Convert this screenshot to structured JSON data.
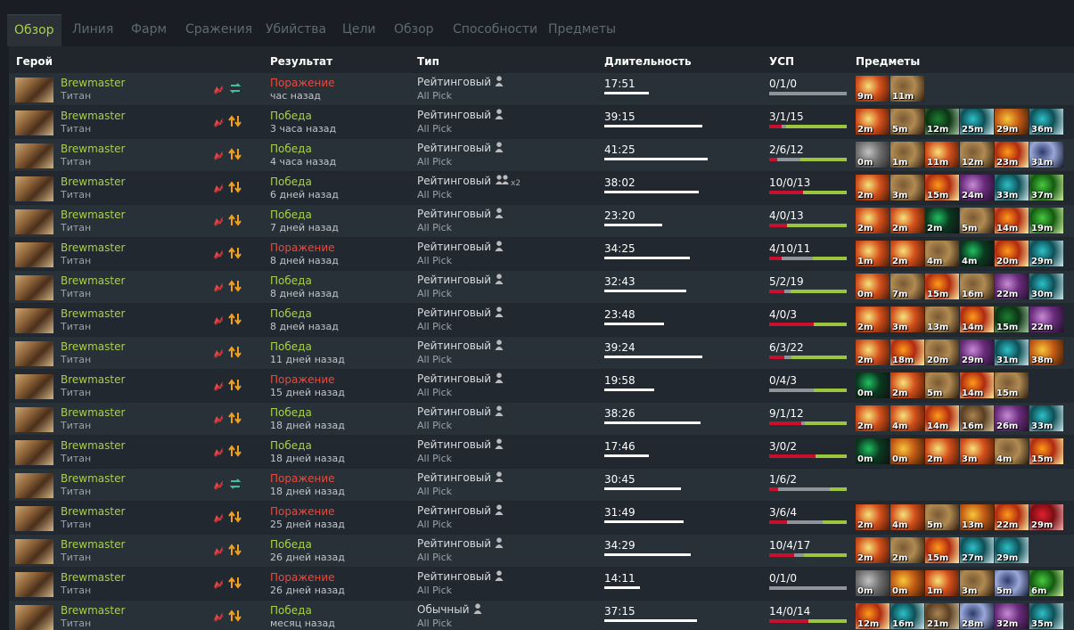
{
  "tabs": [
    "Обзор",
    "Линия",
    "Фарм",
    "Сражения",
    "Убийства",
    "Цели",
    "Обзор",
    "Способности",
    "Предметы"
  ],
  "active_tab": 0,
  "columns": {
    "hero": "Герой",
    "result": "Результат",
    "type": "Тип",
    "duration": "Длительность",
    "kda": "УСП",
    "items": "Предметы"
  },
  "colors": {
    "green": "#a8d04a",
    "red": "#e64b3c",
    "bar_kills": "#c8102e",
    "bar_assists": "#9bc53d",
    "bar_deaths": "#8e9499"
  },
  "item_palette": {
    "1": [
      "#f6e27a",
      "#d4501c",
      "#4a1a06"
    ],
    "2": [
      "#7a5a34",
      "#b08a52",
      "#2a1a0c"
    ],
    "3": [
      "#1d7d33",
      "#0c3214",
      "#a4c8a0"
    ],
    "4": [
      "#2ec0c8",
      "#0d4f56",
      "#cfeaf0"
    ],
    "5": [
      "#f7c63a",
      "#c25a15",
      "#3a1d08"
    ],
    "6": [
      "#2a3a6a",
      "#9aa7d8",
      "#101830"
    ],
    "7": [
      "#c78bd6",
      "#6a2c7c",
      "#22102c"
    ],
    "8": [
      "#48c940",
      "#125a10",
      "#d0f0a0"
    ],
    "9": [
      "#c2c2c2",
      "#6e6e6e",
      "#2a2a2a"
    ],
    "10": [
      "#e02030",
      "#7a0d12",
      "#f4b0b0"
    ],
    "11": [
      "#ff9a1a",
      "#b02a10",
      "#fff0a0"
    ],
    "12": [
      "#a88452",
      "#5a3e22",
      "#d8c39a"
    ],
    "13": [
      "#20c060",
      "#0a3a20",
      "#101010"
    ]
  },
  "rows": [
    {
      "hero": "Brewmaster",
      "hero_sub": "Титан",
      "mode": "rank",
      "result": "Поражение",
      "outcome": "loss",
      "time": "час назад",
      "type": "Рейтинговый",
      "party": "solo",
      "party_count": "",
      "sub": "All Pick",
      "duration": "17:51",
      "duration_minutes": 17.85,
      "kda": "0/1/0",
      "k": 0,
      "d": 1,
      "a": 0,
      "items": [
        {
          "t": "9m",
          "c": "1"
        },
        {
          "t": "11m",
          "c": "2"
        }
      ]
    },
    {
      "hero": "Brewmaster",
      "hero_sub": "Титан",
      "mode": "arrow",
      "result": "Победа",
      "outcome": "win",
      "time": "3 часа назад",
      "type": "Рейтинговый",
      "party": "solo",
      "party_count": "",
      "sub": "All Pick",
      "duration": "39:15",
      "duration_minutes": 39.25,
      "kda": "3/1/15",
      "k": 3,
      "d": 1,
      "a": 15,
      "items": [
        {
          "t": "2m",
          "c": "1"
        },
        {
          "t": "5m",
          "c": "2"
        },
        {
          "t": "12m",
          "c": "3"
        },
        {
          "t": "25m",
          "c": "4"
        },
        {
          "t": "29m",
          "c": "5"
        },
        {
          "t": "36m",
          "c": "4"
        }
      ]
    },
    {
      "hero": "Brewmaster",
      "hero_sub": "Титан",
      "mode": "arrow",
      "result": "Победа",
      "outcome": "win",
      "time": "4 часа назад",
      "type": "Рейтинговый",
      "party": "solo",
      "party_count": "",
      "sub": "All Pick",
      "duration": "41:25",
      "duration_minutes": 41.42,
      "kda": "2/6/12",
      "k": 2,
      "d": 6,
      "a": 12,
      "items": [
        {
          "t": "0m",
          "c": "9"
        },
        {
          "t": "1m",
          "c": "2"
        },
        {
          "t": "11m",
          "c": "1"
        },
        {
          "t": "12m",
          "c": "2"
        },
        {
          "t": "23m",
          "c": "11"
        },
        {
          "t": "31m",
          "c": "6"
        }
      ]
    },
    {
      "hero": "Brewmaster",
      "hero_sub": "Титан",
      "mode": "arrow",
      "result": "Победа",
      "outcome": "win",
      "time": "6 дней назад",
      "type": "Рейтинговый",
      "party": "group",
      "party_count": "x2",
      "sub": "All Pick",
      "duration": "38:02",
      "duration_minutes": 38.03,
      "kda": "10/0/13",
      "k": 10,
      "d": 0,
      "a": 13,
      "items": [
        {
          "t": "2m",
          "c": "1"
        },
        {
          "t": "3m",
          "c": "2"
        },
        {
          "t": "15m",
          "c": "11"
        },
        {
          "t": "24m",
          "c": "7"
        },
        {
          "t": "33m",
          "c": "4"
        },
        {
          "t": "37m",
          "c": "8"
        }
      ]
    },
    {
      "hero": "Brewmaster",
      "hero_sub": "Титан",
      "mode": "arrow",
      "result": "Победа",
      "outcome": "win",
      "time": "7 дней назад",
      "type": "Рейтинговый",
      "party": "solo",
      "party_count": "",
      "sub": "All Pick",
      "duration": "23:20",
      "duration_minutes": 23.33,
      "kda": "4/0/13",
      "k": 4,
      "d": 0,
      "a": 13,
      "items": [
        {
          "t": "2m",
          "c": "1"
        },
        {
          "t": "2m",
          "c": "1"
        },
        {
          "t": "2m",
          "c": "13"
        },
        {
          "t": "5m",
          "c": "2"
        },
        {
          "t": "14m",
          "c": "11"
        },
        {
          "t": "19m",
          "c": "8"
        }
      ]
    },
    {
      "hero": "Brewmaster",
      "hero_sub": "Титан",
      "mode": "arrow",
      "result": "Поражение",
      "outcome": "loss",
      "time": "8 дней назад",
      "type": "Рейтинговый",
      "party": "solo",
      "party_count": "",
      "sub": "All Pick",
      "duration": "34:25",
      "duration_minutes": 34.42,
      "kda": "4/10/11",
      "k": 4,
      "d": 10,
      "a": 11,
      "items": [
        {
          "t": "1m",
          "c": "1"
        },
        {
          "t": "2m",
          "c": "1"
        },
        {
          "t": "4m",
          "c": "2"
        },
        {
          "t": "4m",
          "c": "13"
        },
        {
          "t": "20m",
          "c": "11"
        },
        {
          "t": "29m",
          "c": "4"
        }
      ]
    },
    {
      "hero": "Brewmaster",
      "hero_sub": "Титан",
      "mode": "arrow",
      "result": "Победа",
      "outcome": "win",
      "time": "8 дней назад",
      "type": "Рейтинговый",
      "party": "solo",
      "party_count": "",
      "sub": "All Pick",
      "duration": "32:43",
      "duration_minutes": 32.72,
      "kda": "5/2/19",
      "k": 5,
      "d": 2,
      "a": 19,
      "items": [
        {
          "t": "0m",
          "c": "1"
        },
        {
          "t": "7m",
          "c": "2"
        },
        {
          "t": "15m",
          "c": "11"
        },
        {
          "t": "16m",
          "c": "2"
        },
        {
          "t": "22m",
          "c": "7"
        },
        {
          "t": "30m",
          "c": "4"
        }
      ]
    },
    {
      "hero": "Brewmaster",
      "hero_sub": "Титан",
      "mode": "arrow",
      "result": "Победа",
      "outcome": "win",
      "time": "8 дней назад",
      "type": "Рейтинговый",
      "party": "solo",
      "party_count": "",
      "sub": "All Pick",
      "duration": "23:48",
      "duration_minutes": 23.8,
      "kda": "4/0/3",
      "k": 4,
      "d": 0,
      "a": 3,
      "items": [
        {
          "t": "2m",
          "c": "1"
        },
        {
          "t": "3m",
          "c": "1"
        },
        {
          "t": "13m",
          "c": "2"
        },
        {
          "t": "14m",
          "c": "11"
        },
        {
          "t": "15m",
          "c": "3"
        },
        {
          "t": "22m",
          "c": "7"
        }
      ]
    },
    {
      "hero": "Brewmaster",
      "hero_sub": "Титан",
      "mode": "arrow",
      "result": "Победа",
      "outcome": "win",
      "time": "11 дней назад",
      "type": "Рейтинговый",
      "party": "solo",
      "party_count": "",
      "sub": "All Pick",
      "duration": "39:24",
      "duration_minutes": 39.4,
      "kda": "6/3/22",
      "k": 6,
      "d": 3,
      "a": 22,
      "items": [
        {
          "t": "2m",
          "c": "1"
        },
        {
          "t": "18m",
          "c": "11"
        },
        {
          "t": "20m",
          "c": "2"
        },
        {
          "t": "29m",
          "c": "7"
        },
        {
          "t": "31m",
          "c": "4"
        },
        {
          "t": "38m",
          "c": "5"
        }
      ]
    },
    {
      "hero": "Brewmaster",
      "hero_sub": "Титан",
      "mode": "arrow",
      "result": "Поражение",
      "outcome": "loss",
      "time": "15 дней назад",
      "type": "Рейтинговый",
      "party": "solo",
      "party_count": "",
      "sub": "All Pick",
      "duration": "19:58",
      "duration_minutes": 19.97,
      "kda": "0/4/3",
      "k": 0,
      "d": 4,
      "a": 3,
      "items": [
        {
          "t": "0m",
          "c": "13"
        },
        {
          "t": "2m",
          "c": "1"
        },
        {
          "t": "5m",
          "c": "2"
        },
        {
          "t": "14m",
          "c": "11"
        },
        {
          "t": "15m",
          "c": "2"
        }
      ]
    },
    {
      "hero": "Brewmaster",
      "hero_sub": "Титан",
      "mode": "arrow",
      "result": "Победа",
      "outcome": "win",
      "time": "18 дней назад",
      "type": "Рейтинговый",
      "party": "solo",
      "party_count": "",
      "sub": "All Pick",
      "duration": "38:26",
      "duration_minutes": 38.43,
      "kda": "9/1/12",
      "k": 9,
      "d": 1,
      "a": 12,
      "items": [
        {
          "t": "2m",
          "c": "1"
        },
        {
          "t": "4m",
          "c": "1"
        },
        {
          "t": "14m",
          "c": "11"
        },
        {
          "t": "16m",
          "c": "12"
        },
        {
          "t": "26m",
          "c": "7"
        },
        {
          "t": "33m",
          "c": "4"
        }
      ]
    },
    {
      "hero": "Brewmaster",
      "hero_sub": "Титан",
      "mode": "arrow",
      "result": "Победа",
      "outcome": "win",
      "time": "18 дней назад",
      "type": "Рейтинговый",
      "party": "solo",
      "party_count": "",
      "sub": "All Pick",
      "duration": "17:46",
      "duration_minutes": 17.77,
      "kda": "3/0/2",
      "k": 3,
      "d": 0,
      "a": 2,
      "items": [
        {
          "t": "0m",
          "c": "13"
        },
        {
          "t": "0m",
          "c": "5"
        },
        {
          "t": "2m",
          "c": "1"
        },
        {
          "t": "3m",
          "c": "1"
        },
        {
          "t": "4m",
          "c": "2"
        },
        {
          "t": "15m",
          "c": "11"
        }
      ]
    },
    {
      "hero": "Brewmaster",
      "hero_sub": "Титан",
      "mode": "rank",
      "result": "Поражение",
      "outcome": "loss",
      "time": "18 дней назад",
      "type": "Рейтинговый",
      "party": "solo",
      "party_count": "",
      "sub": "All Pick",
      "duration": "30:45",
      "duration_minutes": 30.75,
      "kda": "1/6/2",
      "k": 1,
      "d": 6,
      "a": 2,
      "items": []
    },
    {
      "hero": "Brewmaster",
      "hero_sub": "Титан",
      "mode": "arrow",
      "result": "Поражение",
      "outcome": "loss",
      "time": "25 дней назад",
      "type": "Рейтинговый",
      "party": "solo",
      "party_count": "",
      "sub": "All Pick",
      "duration": "31:49",
      "duration_minutes": 31.82,
      "kda": "3/6/4",
      "k": 3,
      "d": 6,
      "a": 4,
      "items": [
        {
          "t": "2m",
          "c": "1"
        },
        {
          "t": "4m",
          "c": "1"
        },
        {
          "t": "5m",
          "c": "2"
        },
        {
          "t": "13m",
          "c": "5"
        },
        {
          "t": "22m",
          "c": "11"
        },
        {
          "t": "29m",
          "c": "10"
        }
      ]
    },
    {
      "hero": "Brewmaster",
      "hero_sub": "Титан",
      "mode": "arrow",
      "result": "Победа",
      "outcome": "win",
      "time": "26 дней назад",
      "type": "Рейтинговый",
      "party": "solo",
      "party_count": "",
      "sub": "All Pick",
      "duration": "34:29",
      "duration_minutes": 34.48,
      "kda": "10/4/17",
      "k": 10,
      "d": 4,
      "a": 17,
      "items": [
        {
          "t": "2m",
          "c": "1"
        },
        {
          "t": "2m",
          "c": "2"
        },
        {
          "t": "15m",
          "c": "11"
        },
        {
          "t": "27m",
          "c": "4"
        },
        {
          "t": "29m",
          "c": "4"
        }
      ]
    },
    {
      "hero": "Brewmaster",
      "hero_sub": "Титан",
      "mode": "arrow",
      "result": "Поражение",
      "outcome": "loss",
      "time": "26 дней назад",
      "type": "Рейтинговый",
      "party": "solo",
      "party_count": "",
      "sub": "All Pick",
      "duration": "14:11",
      "duration_minutes": 14.18,
      "kda": "0/1/0",
      "k": 0,
      "d": 1,
      "a": 0,
      "items": [
        {
          "t": "0m",
          "c": "9"
        },
        {
          "t": "0m",
          "c": "5"
        },
        {
          "t": "1m",
          "c": "1"
        },
        {
          "t": "3m",
          "c": "2"
        },
        {
          "t": "5m",
          "c": "6"
        },
        {
          "t": "6m",
          "c": "8"
        }
      ]
    },
    {
      "hero": "Brewmaster",
      "hero_sub": "Титан",
      "mode": "arrow",
      "result": "Победа",
      "outcome": "win",
      "time": "месяц назад",
      "type": "Обычный",
      "party": "solo",
      "party_count": "",
      "sub": "All Pick",
      "duration": "37:15",
      "duration_minutes": 37.25,
      "kda": "14/0/14",
      "k": 14,
      "d": 0,
      "a": 14,
      "items": [
        {
          "t": "12m",
          "c": "11"
        },
        {
          "t": "16m",
          "c": "4"
        },
        {
          "t": "21m",
          "c": "12"
        },
        {
          "t": "28m",
          "c": "6"
        },
        {
          "t": "32m",
          "c": "7"
        },
        {
          "t": "35m",
          "c": "4"
        }
      ]
    }
  ]
}
